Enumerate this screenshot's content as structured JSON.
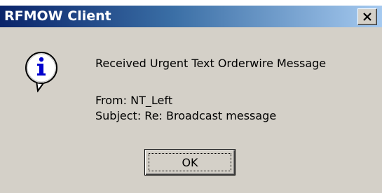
{
  "window": {
    "title": "RFMOW Client",
    "close_label": "close"
  },
  "icon": {
    "name": "info-icon",
    "glyph": "i",
    "color": "#0000cc"
  },
  "message": {
    "headline": "Received Urgent Text Orderwire Message",
    "from": "From: NT_Left",
    "subject": "Subject: Re: Broadcast message"
  },
  "buttons": {
    "ok_label": "OK"
  },
  "colors": {
    "title_bar_start": "#0a246a",
    "title_bar_end": "#a6caf0",
    "dialog_face": "#d4d0c8"
  }
}
